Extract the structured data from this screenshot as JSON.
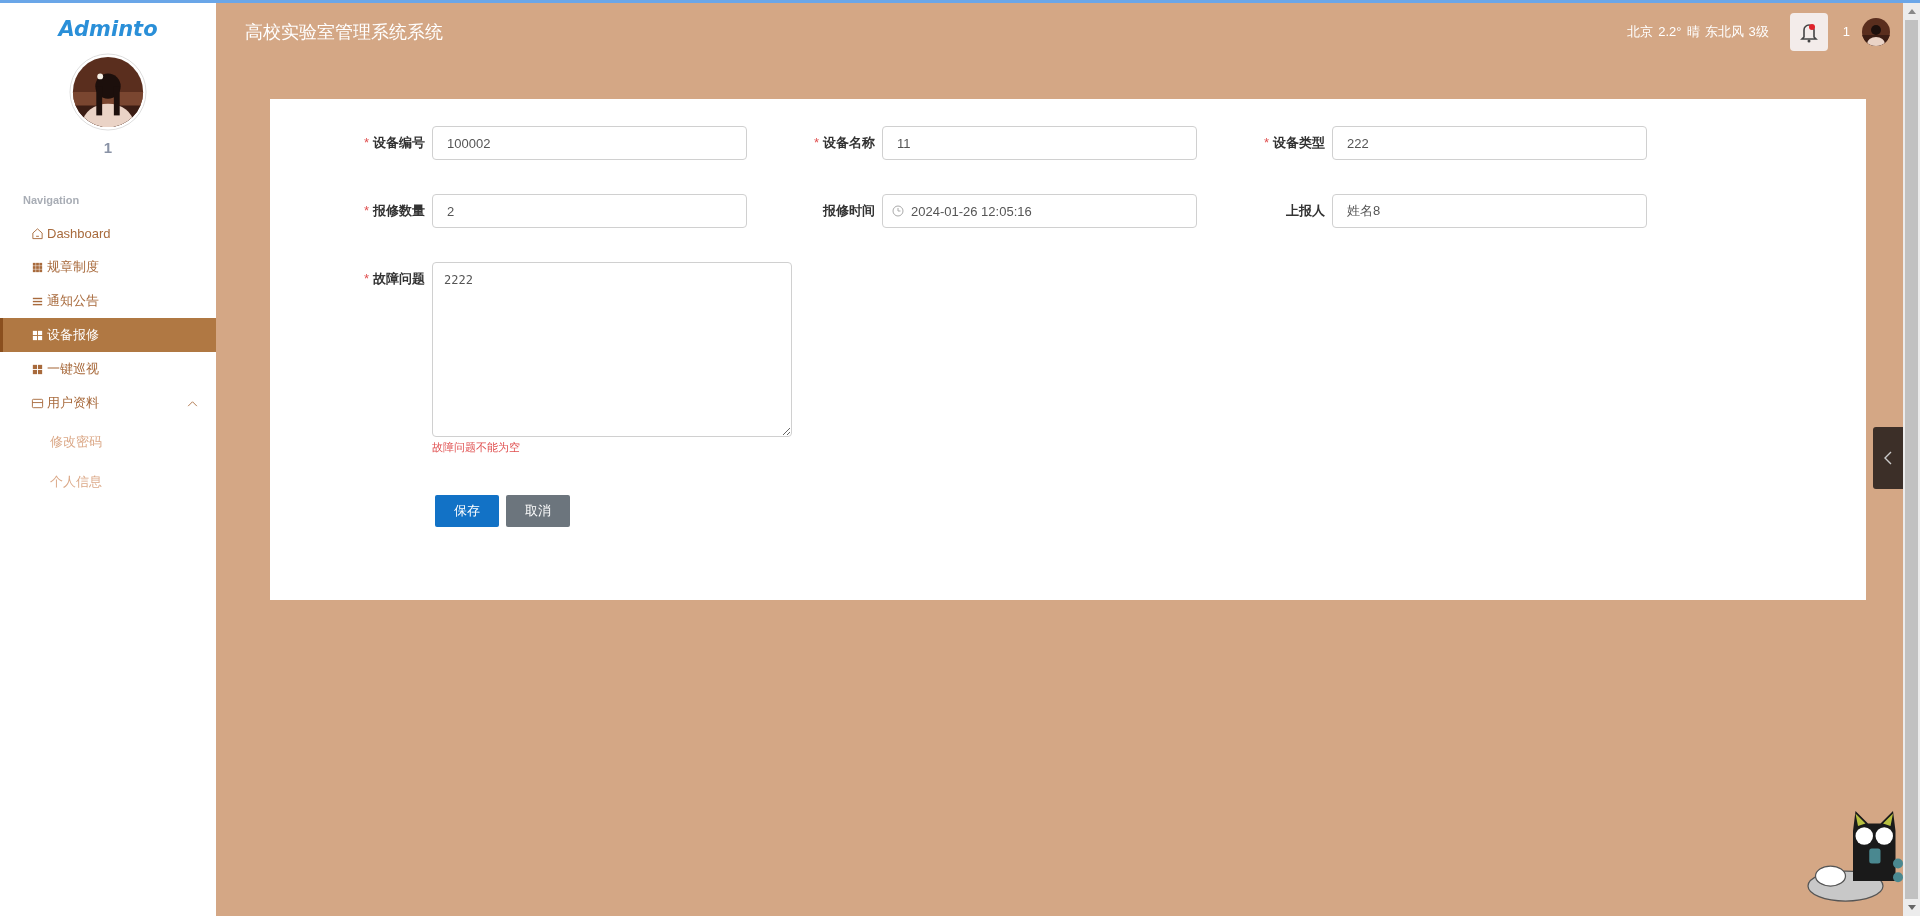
{
  "sidebar": {
    "logo": "Adminto",
    "user_name": "1",
    "section": "Navigation",
    "items": [
      {
        "label": "Dashboard",
        "selected": false
      },
      {
        "label": "规章制度",
        "selected": false
      },
      {
        "label": "通知公告",
        "selected": false
      },
      {
        "label": "设备报修",
        "selected": true
      },
      {
        "label": "一键巡视",
        "selected": false
      },
      {
        "label": "用户资料",
        "selected": false,
        "expanded": true,
        "children": [
          {
            "label": "修改密码",
            "selected": false
          },
          {
            "label": "个人信息",
            "selected": false
          }
        ]
      }
    ]
  },
  "header": {
    "title": "高校实验室管理系统系统",
    "weather": [
      "北京",
      "2.2°",
      "晴",
      "东北风",
      "3级"
    ],
    "has_notification": true,
    "user_name": "1"
  },
  "form": {
    "rows": [
      {
        "fields": [
          {
            "label": "设备编号",
            "required_mark": "*",
            "kind": "text",
            "value": "100002"
          },
          {
            "label": "设备名称",
            "required_mark": "*",
            "kind": "text",
            "value": "11"
          },
          {
            "label": "设备类型",
            "required_mark": "*",
            "kind": "text",
            "value": "222"
          }
        ]
      },
      {
        "fields": [
          {
            "label": "报修数量",
            "required_mark": "*",
            "kind": "text",
            "value": "2"
          },
          {
            "label": "报修时间",
            "kind": "datetime",
            "value": "2024-01-26 12:05:16"
          },
          {
            "label": "上报人",
            "kind": "text",
            "value": "姓名8"
          }
        ]
      },
      {
        "fields": [
          {
            "label": "故障问题",
            "required_mark": "*",
            "kind": "textarea",
            "value": "2222",
            "error": "故障问题不能为空"
          }
        ]
      }
    ],
    "buttons": [
      {
        "label": "保存",
        "kind": "primary"
      },
      {
        "label": "取消",
        "kind": "secondary"
      }
    ]
  }
}
